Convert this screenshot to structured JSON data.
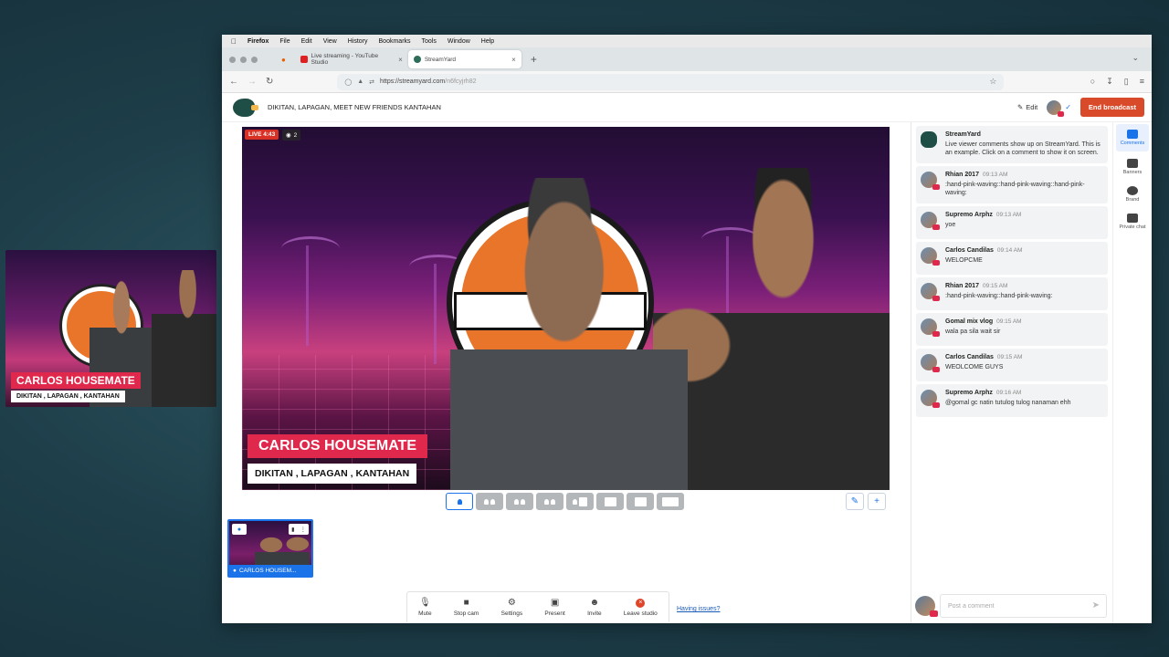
{
  "float_preview": {
    "name": "CARLOS HOUSEMATE",
    "subtitle": "DIKITAN , LAPAGAN , KANTAHAN"
  },
  "menubar": {
    "app": "Firefox",
    "items": [
      "File",
      "Edit",
      "View",
      "History",
      "Bookmarks",
      "Tools",
      "Window",
      "Help"
    ]
  },
  "tabs": [
    {
      "label": "Live streaming - YouTube Studio",
      "icon": "youtube-icon",
      "active": false
    },
    {
      "label": "StreamYard",
      "icon": "streamyard-icon",
      "active": true
    }
  ],
  "url": {
    "host": "https://streamyard.com",
    "path": "/n6fcyjrh82"
  },
  "header": {
    "title": "DIKITAN, LAPAGAN, MEET NEW FRIENDS KANTAHAN",
    "edit_label": "Edit",
    "end_label": "End broadcast"
  },
  "stage": {
    "live_label": "LIVE 4:43",
    "viewers": "2",
    "name": "CARLOS HOUSEMATE",
    "subtitle": "DIKITAN , LAPAGAN , KANTAHAN"
  },
  "backstage": {
    "label": "CARLOS HOUSEM..."
  },
  "controls": [
    {
      "label": "Mute",
      "icon": "mic-icon"
    },
    {
      "label": "Stop cam",
      "icon": "camera-icon"
    },
    {
      "label": "Settings",
      "icon": "gear-icon"
    },
    {
      "label": "Present",
      "icon": "present-icon"
    },
    {
      "label": "Invite",
      "icon": "invite-icon"
    },
    {
      "label": "Leave studio",
      "icon": "leave-icon"
    }
  ],
  "having_issues": "Having issues?",
  "chat": [
    {
      "name": "StreamYard",
      "time": "",
      "text": "Live viewer comments show up on StreamYard. This is an example. Click on a comment to show it on screen."
    },
    {
      "name": "Rhian 2017",
      "time": "09:13 AM",
      "text": ":hand-pink-waving::hand-pink-waving::hand-pink-waving:"
    },
    {
      "name": "Supremo Arphz",
      "time": "09:13 AM",
      "text": "yoe"
    },
    {
      "name": "Carlos Candilas",
      "time": "09:14 AM",
      "text": "WELOPCME"
    },
    {
      "name": "Rhian 2017",
      "time": "09:15 AM",
      "text": ":hand-pink-waving::hand-pink-waving:"
    },
    {
      "name": "Gomal mix vlog",
      "time": "09:15 AM",
      "text": "wala pa sila wait sir"
    },
    {
      "name": "Carlos Candilas",
      "time": "09:15 AM",
      "text": "WEOLCOME GUYS"
    },
    {
      "name": "Supremo Arphz",
      "time": "09:16 AM",
      "text": "@gomal gc natin tutulog tulog nanaman ehh"
    }
  ],
  "chat_input": {
    "placeholder": "Post a comment"
  },
  "side_tabs": [
    {
      "label": "Comments",
      "icon": "comments-icon",
      "active": true
    },
    {
      "label": "Banners",
      "icon": "banners-icon",
      "active": false
    },
    {
      "label": "Brand",
      "icon": "brand-icon",
      "active": false
    },
    {
      "label": "Private chat",
      "icon": "private-chat-icon",
      "active": false
    }
  ]
}
